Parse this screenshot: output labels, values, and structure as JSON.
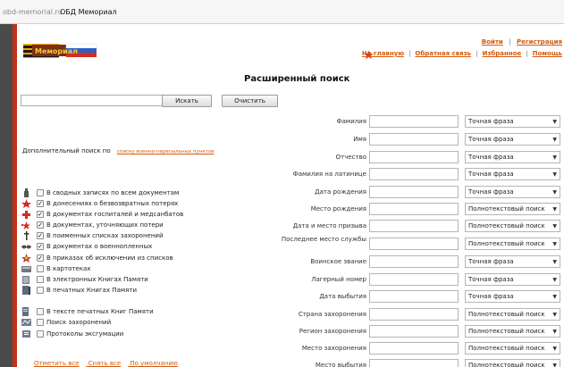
{
  "browser": {
    "host": "obd-memorial.ru",
    "title": "ОБД Мемориал"
  },
  "header": {
    "logo_text": "Мемориал",
    "auth_links": [
      "Войти",
      "Регистрация"
    ],
    "nav_links": [
      "На главную",
      "Обратная связь",
      "Избранное",
      "Помощь"
    ]
  },
  "page_title": "Расширенный поиск",
  "search": {
    "value": "",
    "search_button": "Искать",
    "clear_button": "Очистить"
  },
  "additional": {
    "label": "Дополнительный поиск по",
    "link": "списку военно-пересыльных пунктов"
  },
  "checkbox_groups": [
    {
      "label": "В сводных записях по всем документам",
      "checked": false,
      "icon": "soldier-icon"
    },
    {
      "label": "В донесениях о безвозвратных потерях",
      "checked": true,
      "icon": "red-star-icon"
    },
    {
      "label": "В документах госпиталей и медсанбатов",
      "checked": true,
      "icon": "red-cross-icon"
    },
    {
      "label": "В документах, уточняющих потери",
      "checked": true,
      "icon": "star-small-icon"
    },
    {
      "label": "В поименных списках захоронений",
      "checked": true,
      "icon": "grave-icon"
    },
    {
      "label": "В документах о военнопленных",
      "checked": true,
      "icon": "barbed-wire-icon"
    },
    {
      "label": "В приказах об исключении из списков",
      "checked": true,
      "icon": "order-star-icon"
    },
    {
      "label": "В картотеках",
      "checked": false,
      "icon": "card-index-icon"
    },
    {
      "label": "В электронных Книгах Памяти",
      "checked": false,
      "icon": "memory-book-icon"
    },
    {
      "label": "В печатных Книгах Памяти",
      "checked": false,
      "icon": "printed-book-icon"
    },
    {
      "label": "В тексте печатных Книг Памяти",
      "checked": false,
      "icon": "text-book-icon"
    },
    {
      "label": "Поиск захоронений",
      "checked": false,
      "icon": "map-icon"
    },
    {
      "label": "Протоколы эксгумации",
      "checked": false,
      "icon": "protocol-icon"
    }
  ],
  "bottom_links": [
    "Отметить все",
    "Снять все",
    "По умолчанию"
  ],
  "fields": [
    {
      "label": "Фамилия",
      "mode": "Точная фраза"
    },
    {
      "label": "Имя",
      "mode": "Точная фраза"
    },
    {
      "label": "Отчество",
      "mode": "Точная фраза"
    },
    {
      "label": "Фамилия на латинице",
      "mode": "Точная фраза"
    },
    {
      "label": "Дата рождения",
      "mode": "Точная фраза"
    },
    {
      "label": "Место рождения",
      "mode": "Полнотекстовый поиск"
    },
    {
      "label": "Дата и место призыва",
      "mode": "Полнотекстовый поиск"
    },
    {
      "label": "Последнее место службы",
      "mode": "Полнотекстовый поиск"
    },
    {
      "label": "Воинское звание",
      "mode": "Точная фраза"
    },
    {
      "label": "Лагерный номер",
      "mode": "Точная фраза"
    },
    {
      "label": "Дата выбытия",
      "mode": "Точная фраза"
    },
    {
      "label": "Страна захоронения",
      "mode": "Полнотекстовый поиск"
    },
    {
      "label": "Регион захоронения",
      "mode": "Полнотекстовый поиск"
    },
    {
      "label": "Место захоронения",
      "mode": "Полнотекстовый поиск"
    },
    {
      "label": "Место выбытия",
      "mode": "Полнотекстовый поиск"
    }
  ]
}
